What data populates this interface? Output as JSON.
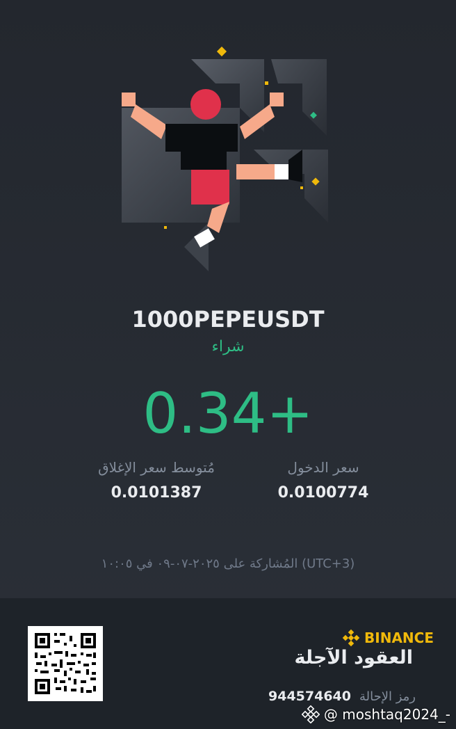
{
  "trade": {
    "symbol": "1000PEPEUSDT",
    "side": "شراء",
    "pnl": "0.34+",
    "entry_label": "سعر الدخول",
    "entry_value": "0.0100774",
    "close_label": "مُتوسط سعر الإغلاق",
    "close_value": "0.0101387",
    "shared": "المُشاركة على ٢٠٢٥-٠٧-٠٩ في ١٠:٠٥ (UTC+3)"
  },
  "footer": {
    "brand": "BINANCE",
    "product": "العقود الآجلة",
    "referral_label": "رمز الإحالة",
    "referral_code": "944574640"
  },
  "watermark": {
    "text": "@ moshtaq2024_-"
  },
  "colors": {
    "positive": "#2ebd85",
    "brand": "#f0b90b",
    "background": "#2b3139"
  },
  "icons": [
    "hero-illustration",
    "binance-logo-icon",
    "qr-code",
    "binance-watermark-icon"
  ]
}
